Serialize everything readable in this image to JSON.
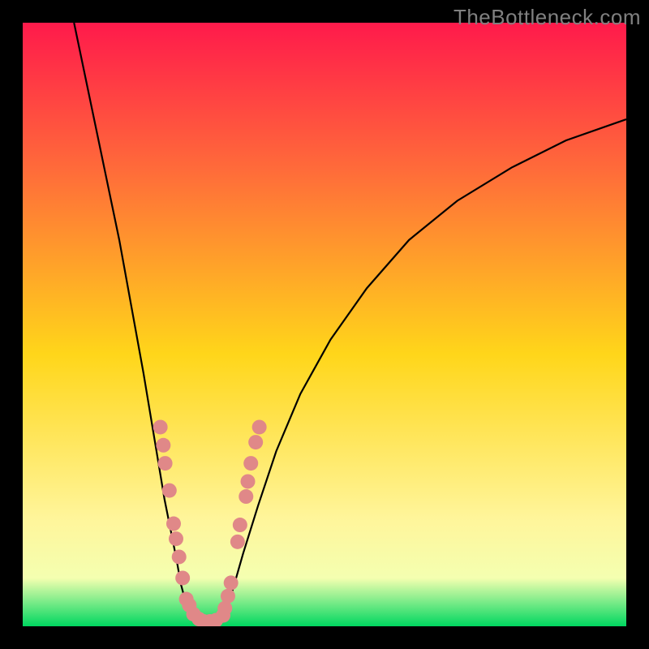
{
  "watermark": "TheBottleneck.com",
  "colors": {
    "background": "#000000",
    "curve_stroke": "#000000",
    "marker_fill": "#e08888",
    "gradient_top": "#ff1a4b",
    "gradient_upper": "#ff6a3a",
    "gradient_mid": "#ffd61a",
    "gradient_lower": "#fff59a",
    "gradient_bottom": "#00d760",
    "watermark_text": "#808080"
  },
  "chart_data": {
    "type": "line",
    "title": "",
    "xlabel": "",
    "ylabel": "",
    "xlim": [
      0,
      1
    ],
    "ylim": [
      0,
      1
    ],
    "series": [
      {
        "name": "bottleneck-curve-left",
        "x": [
          0.085,
          0.11,
          0.135,
          0.16,
          0.18,
          0.2,
          0.215,
          0.225,
          0.235,
          0.245,
          0.255,
          0.262,
          0.27,
          0.278
        ],
        "y": [
          1.0,
          0.88,
          0.76,
          0.64,
          0.53,
          0.42,
          0.33,
          0.27,
          0.21,
          0.16,
          0.11,
          0.07,
          0.04,
          0.015
        ]
      },
      {
        "name": "bottleneck-floor",
        "x": [
          0.278,
          0.29,
          0.3,
          0.31,
          0.32,
          0.33
        ],
        "y": [
          0.015,
          0.006,
          0.004,
          0.004,
          0.006,
          0.012
        ]
      },
      {
        "name": "bottleneck-curve-right",
        "x": [
          0.33,
          0.345,
          0.365,
          0.39,
          0.42,
          0.46,
          0.51,
          0.57,
          0.64,
          0.72,
          0.81,
          0.9,
          1.0
        ],
        "y": [
          0.012,
          0.05,
          0.12,
          0.2,
          0.29,
          0.385,
          0.475,
          0.56,
          0.64,
          0.705,
          0.76,
          0.805,
          0.84
        ]
      }
    ],
    "markers": [
      {
        "x": 0.228,
        "y": 0.33
      },
      {
        "x": 0.233,
        "y": 0.3
      },
      {
        "x": 0.236,
        "y": 0.27
      },
      {
        "x": 0.243,
        "y": 0.225
      },
      {
        "x": 0.25,
        "y": 0.17
      },
      {
        "x": 0.254,
        "y": 0.145
      },
      {
        "x": 0.259,
        "y": 0.115
      },
      {
        "x": 0.265,
        "y": 0.08
      },
      {
        "x": 0.271,
        "y": 0.045
      },
      {
        "x": 0.276,
        "y": 0.035
      },
      {
        "x": 0.283,
        "y": 0.02
      },
      {
        "x": 0.292,
        "y": 0.012
      },
      {
        "x": 0.3,
        "y": 0.008
      },
      {
        "x": 0.31,
        "y": 0.008
      },
      {
        "x": 0.32,
        "y": 0.01
      },
      {
        "x": 0.332,
        "y": 0.018
      },
      {
        "x": 0.335,
        "y": 0.03
      },
      {
        "x": 0.34,
        "y": 0.05
      },
      {
        "x": 0.345,
        "y": 0.072
      },
      {
        "x": 0.356,
        "y": 0.14
      },
      {
        "x": 0.36,
        "y": 0.168
      },
      {
        "x": 0.37,
        "y": 0.215
      },
      {
        "x": 0.373,
        "y": 0.24
      },
      {
        "x": 0.378,
        "y": 0.27
      },
      {
        "x": 0.386,
        "y": 0.305
      },
      {
        "x": 0.392,
        "y": 0.33
      }
    ]
  }
}
